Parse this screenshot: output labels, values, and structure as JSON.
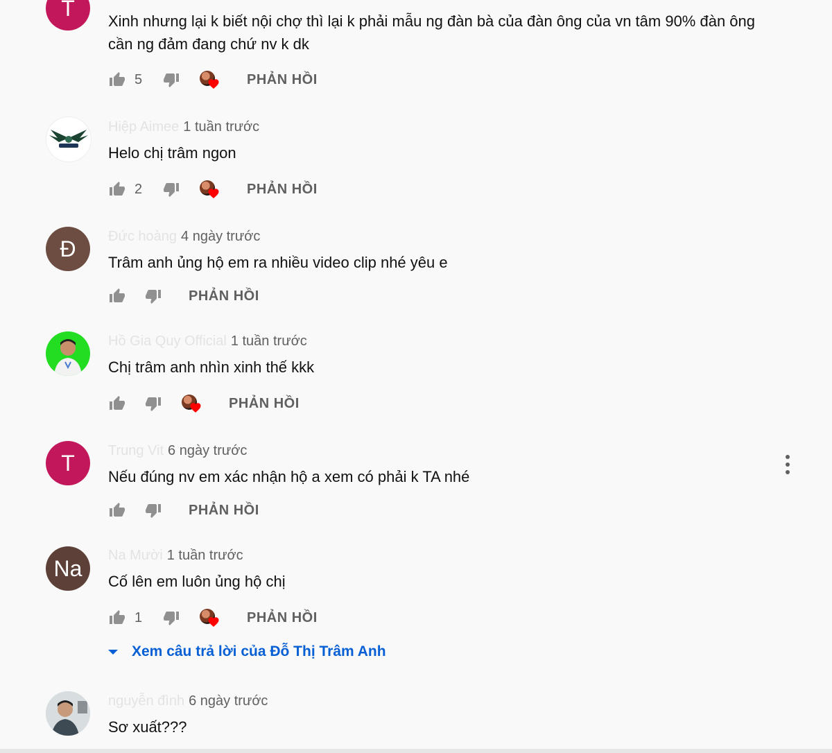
{
  "comments": [
    {
      "avatar_letter": "T",
      "avatar_color": "#c2185b",
      "author": "",
      "time": "",
      "text_lines": [
        "Xinh nhưng lại k biết nội chợ thì lại k phải mẫu ng đàn bà của đàn ông của vn tâm 90% đàn ông",
        "cần ng đảm đang chứ nv k dk"
      ],
      "likes": "5",
      "creator_heart": true,
      "reply_label": "PHẢN HỒI"
    },
    {
      "avatar_letter": "",
      "avatar_color": "#ffffff",
      "author": "Hiệp Aimee",
      "time": "1 tuần trước",
      "text_lines": [
        "Helo chị trâm ngon"
      ],
      "likes": "2",
      "creator_heart": true,
      "reply_label": "PHẢN HỒI"
    },
    {
      "avatar_letter": "Đ",
      "avatar_color": "#6d4c41",
      "author": "Đức hoàng",
      "time": "4 ngày trước",
      "text_lines": [
        "Trâm anh ủng hộ em ra nhiều video clip nhé yêu e"
      ],
      "likes": "",
      "creator_heart": false,
      "reply_label": "PHẢN HỒI"
    },
    {
      "avatar_letter": "",
      "avatar_color": "#22dd22",
      "author": "Hồ Gia Quy Official",
      "time": "1 tuần trước",
      "text_lines": [
        "Chị trâm anh nhìn xinh thế kkk"
      ],
      "likes": "",
      "creator_heart": true,
      "reply_label": "PHẢN HỒI"
    },
    {
      "avatar_letter": "T",
      "avatar_color": "#c2185b",
      "author": "Trung Vit",
      "time": "6 ngày trước",
      "text_lines": [
        "Nếu đúng nv em xác nhận hộ a xem có phải k TA nhé"
      ],
      "likes": "",
      "creator_heart": false,
      "reply_label": "PHẢN HỒI"
    },
    {
      "avatar_letter": "Na",
      "avatar_color": "#5d4037",
      "author": "Na Mười",
      "time": "1 tuần trước",
      "text_lines": [
        "Cố lên em luôn ủng hộ chị"
      ],
      "likes": "1",
      "creator_heart": true,
      "reply_label": "PHẢN HỒI"
    },
    {
      "avatar_letter": "",
      "avatar_color": "#cfd8dc",
      "author": "nguyễn đình",
      "time": "6 ngày trước",
      "text_lines": [
        "Sơ xuất???"
      ],
      "likes": "",
      "creator_heart": false,
      "reply_label": ""
    }
  ],
  "view_replies": "Xem câu trả lời của Đỗ Thị Trâm Anh",
  "colors": {
    "accent": "#065fd4",
    "secondary_text": "#606060",
    "heart": "#ff0000"
  },
  "icons": [
    "thumbs-up-icon",
    "thumbs-down-icon",
    "creator-heart-icon",
    "caret-down-icon",
    "more-vert-icon"
  ]
}
